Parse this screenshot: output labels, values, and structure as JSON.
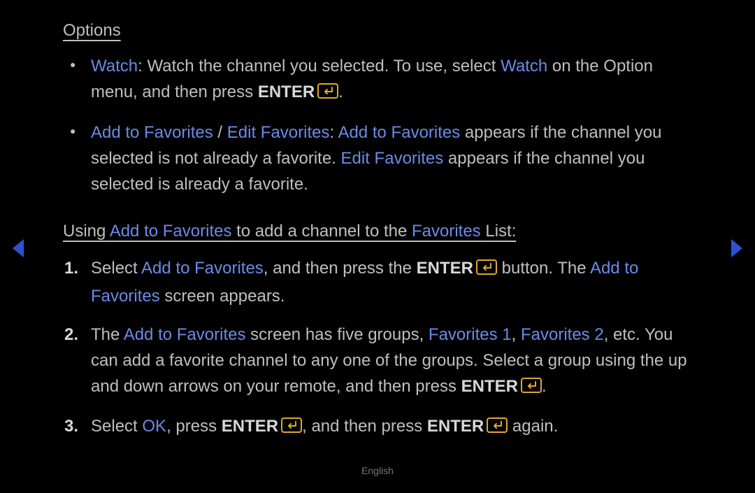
{
  "sectionTitle": "Options",
  "bullet1": {
    "kw1": "Watch",
    "t1": ": Watch the channel you selected. To use, select ",
    "kw2": "Watch",
    "t2": " on the Option menu, and then press ",
    "enter": "ENTER",
    "t3": "."
  },
  "bullet2": {
    "kw1": "Add to Favorites",
    "sep": " / ",
    "kw2": "Edit Favorites",
    "t1": ": ",
    "kw3": "Add to Favorites",
    "t2": " appears if the channel you selected is not already a favorite. ",
    "kw4": "Edit Favorites",
    "t3": " appears if the channel you selected is already a favorite."
  },
  "subheading": {
    "t1": "Using ",
    "kw1": "Add to Favorites",
    "t2": " to add a channel to the ",
    "kw2": "Favorites",
    "t3": " List:"
  },
  "step1": {
    "t1": "Select ",
    "kw1": "Add to Favorites",
    "t2": ", and then press the ",
    "enter": "ENTER",
    "t3": " button. The ",
    "kw2": "Add to Favorites",
    "t4": " screen appears."
  },
  "step2": {
    "t1": "The ",
    "kw1": "Add to Favorites",
    "t2": " screen has five groups, ",
    "kw2": "Favorites 1",
    "sep": ", ",
    "kw3": "Favorites 2",
    "t3": ", etc. You can add a favorite channel to any one of the groups. Select a group using the up and down arrows on your remote, and then press ",
    "enter": "ENTER",
    "t4": "."
  },
  "step3": {
    "t1": "Select ",
    "kw1": "OK",
    "t2": ", press ",
    "enter1": "ENTER",
    "t3": ", and then press ",
    "enter2": "ENTER",
    "t4": " again."
  },
  "footer": "English"
}
